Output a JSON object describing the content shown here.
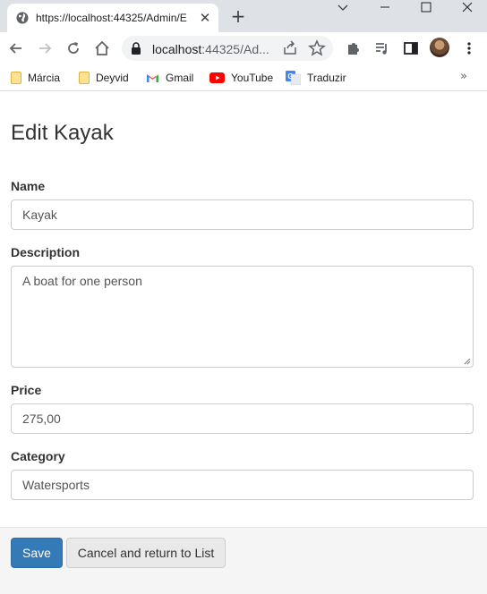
{
  "browser": {
    "tab_title": "https://localhost:44325/Admin/E",
    "url_host": "localhost",
    "url_rest": ":44325/Ad...",
    "bookmarks": [
      {
        "label": "Márcia",
        "icon": "folder-icon"
      },
      {
        "label": "Deyvid",
        "icon": "folder-icon"
      },
      {
        "label": "Gmail",
        "icon": "gmail-icon"
      },
      {
        "label": "YouTube",
        "icon": "youtube-icon"
      },
      {
        "label": "Traduzir",
        "icon": "translate-icon"
      }
    ],
    "bookmarks_more": "»"
  },
  "page": {
    "title": "Edit Kayak",
    "fields": {
      "name": {
        "label": "Name",
        "value": "Kayak"
      },
      "description": {
        "label": "Description",
        "value": "A boat for one person"
      },
      "price": {
        "label": "Price",
        "value": "275,00"
      },
      "category": {
        "label": "Category",
        "value": "Watersports"
      }
    },
    "buttons": {
      "save": "Save",
      "cancel": "Cancel and return to List"
    }
  },
  "colors": {
    "primary": "#337ab7",
    "footer_bg": "#f5f5f5",
    "chrome_bg": "#dee1e6"
  }
}
